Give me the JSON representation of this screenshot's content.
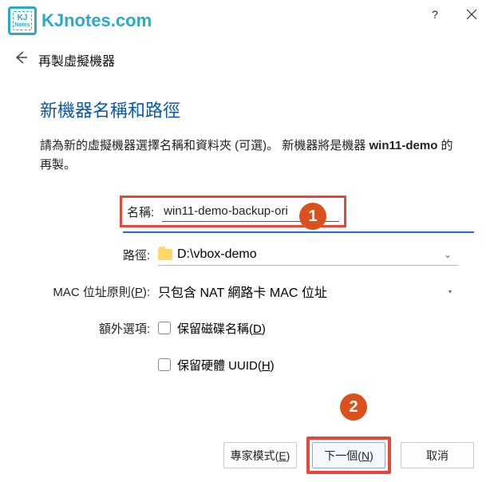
{
  "watermark": {
    "logo_top": "KJ",
    "logo_bottom": "Notes",
    "text": "KJnotes.com"
  },
  "window": {
    "help_label": "?",
    "close_label": "✕"
  },
  "subheader": {
    "title": "再製虛擬機器"
  },
  "page": {
    "title": "新機器名稱和路徑",
    "desc_prefix": "請為新的虛擬機器選擇名稱和資料夾 (可選)。 新機器將是機器 ",
    "desc_bold": "win11-demo",
    "desc_suffix": " 的再製。"
  },
  "form": {
    "name_label": "名稱:",
    "name_value": "win11-demo-backup-ori",
    "path_label": "路徑:",
    "path_value": "D:\\vbox-demo",
    "mac_label": "MAC 位址原則(",
    "mac_hotkey": "P",
    "mac_label_suffix": "):",
    "mac_value": "只包含 NAT 網路卡 MAC 位址",
    "extra_label": "額外選項:",
    "keep_disk_prefix": "保留磁碟名稱(",
    "keep_disk_hotkey": "D",
    "keep_disk_suffix": ")",
    "keep_hw_prefix": "保留硬體 UUID(",
    "keep_hw_hotkey": "H",
    "keep_hw_suffix": ")"
  },
  "footer": {
    "expert_prefix": "專家模式(",
    "expert_hotkey": "E",
    "expert_suffix": ")",
    "next_prefix": "下一個(",
    "next_hotkey": "N",
    "next_suffix": ")",
    "cancel": "取消"
  },
  "annotations": {
    "b1": "1",
    "b2": "2"
  }
}
